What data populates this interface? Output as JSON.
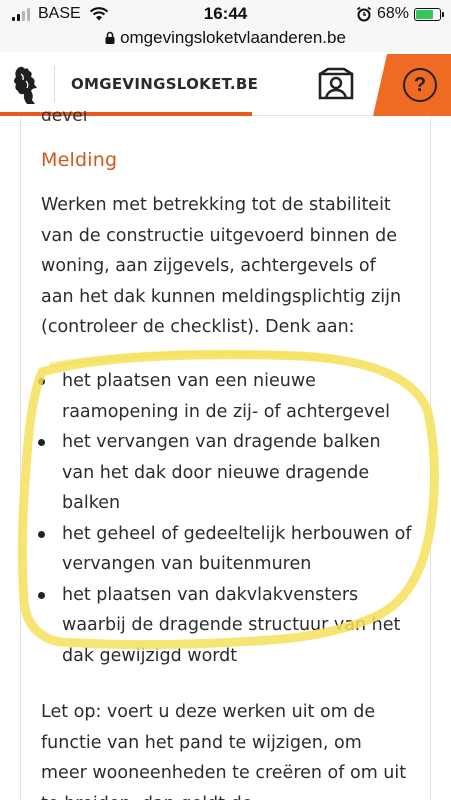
{
  "status_bar": {
    "carrier": "BASE",
    "time": "16:44",
    "battery": "68%"
  },
  "url_bar": {
    "url": "omgevingsloketvlaanderen.be"
  },
  "header": {
    "brand": "OMGEVINGSLOKET.BE",
    "help_label": "?",
    "accent_color": "#ef6a22"
  },
  "content": {
    "cut_text": "gevel",
    "heading": "Melding",
    "intro": "Werken met betrekking tot de stabiliteit van de constructie uitgevoerd binnen de woning, aan zijgevels, achtergevels of aan het dak kunnen meldingsplichtig zijn (controleer de checklist). Denk aan:",
    "items": [
      "het plaatsen van een nieuwe raamopening in de zij- of achtergevel",
      "het vervangen van dragende balken van het dak door nieuwe dragende balken",
      "het geheel of gedeeltelijk herbouwen of vervangen van buitenmuren",
      "het plaatsen van dakvlakvensters waarbij de dragende structuur van het dak gewijzigd wordt"
    ],
    "note": "Let op: voert u deze werken uit om de functie van het pand te wijzigen, om meer wooneenheden te creëren of om uit te breiden, dan geldt de"
  },
  "annotation": {
    "highlight_color": "#f5e15a"
  }
}
